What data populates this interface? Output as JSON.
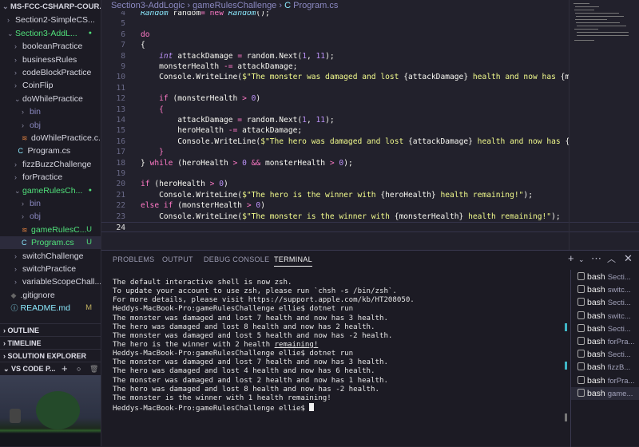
{
  "sidebar": {
    "root": "MS-FCC-CSHARP-COUR...",
    "items": [
      {
        "label": "Section2-SimpleCS...",
        "chev": ">",
        "depth": 1,
        "color": "#d6d6e0"
      },
      {
        "label": "Section3-AddL...",
        "chev": "v",
        "depth": 1,
        "color": "#50e07a",
        "badge": "●"
      },
      {
        "label": "booleanPractice",
        "chev": ">",
        "depth": 2,
        "color": "#d6d6e0"
      },
      {
        "label": "businessRules",
        "chev": ">",
        "depth": 2,
        "color": "#d6d6e0"
      },
      {
        "label": "codeBlockPractice",
        "chev": ">",
        "depth": 2,
        "color": "#d6d6e0"
      },
      {
        "label": "CoinFlip",
        "chev": ">",
        "depth": 2,
        "color": "#d6d6e0"
      },
      {
        "label": "doWhilePractice",
        "chev": "v",
        "depth": 2,
        "color": "#d6d6e0"
      },
      {
        "label": "bin",
        "chev": ">",
        "depth": 3,
        "color": "#8a88c0"
      },
      {
        "label": "obj",
        "chev": ">",
        "depth": 3,
        "color": "#8a88c0"
      },
      {
        "label": "doWhilePractice.c...",
        "icon": "rss",
        "depth": 3,
        "color": "#d6d6e0"
      },
      {
        "label": "Program.cs",
        "icon": "cs",
        "depth": 2.5,
        "color": "#d6d6e0"
      },
      {
        "label": "fizzBuzzChallenge",
        "chev": ">",
        "depth": 2,
        "color": "#d6d6e0"
      },
      {
        "label": "forPractice",
        "chev": ">",
        "depth": 2,
        "color": "#d6d6e0"
      },
      {
        "label": "gameRulesCh...",
        "chev": "v",
        "depth": 2,
        "color": "#50e07a",
        "badge": "●"
      },
      {
        "label": "bin",
        "chev": ">",
        "depth": 3,
        "color": "#8a88c0"
      },
      {
        "label": "obj",
        "chev": ">",
        "depth": 3,
        "color": "#8a88c0"
      },
      {
        "label": "gameRulesC...",
        "icon": "rss",
        "depth": 3,
        "color": "#50e07a",
        "badge": "U"
      },
      {
        "label": "Program.cs",
        "icon": "cs",
        "depth": 3,
        "color": "#50e07a",
        "badge": "U",
        "selected": true
      },
      {
        "label": "switchChallenge",
        "chev": ">",
        "depth": 2,
        "color": "#d6d6e0"
      },
      {
        "label": "switchPractice",
        "chev": ">",
        "depth": 2,
        "color": "#d6d6e0"
      },
      {
        "label": "variableScopeChall...",
        "chev": ">",
        "depth": 2,
        "color": "#d6d6e0"
      },
      {
        "label": ".gitignore",
        "icon": "git",
        "depth": 1.5,
        "color": "#d6d6e0"
      },
      {
        "label": "README.md",
        "icon": "info",
        "depth": 1.5,
        "color": "#8be9fd",
        "badge": "M"
      }
    ],
    "sections": [
      "OUTLINE",
      "TIMELINE",
      "SOLUTION EXPLORER"
    ],
    "pets_title": "VS CODE P..."
  },
  "breadcrumb": {
    "folder": "Section3-AddLogic",
    "sub": "gameRulesChallenge",
    "file": "Program.cs"
  },
  "code": [
    {
      "n": "4",
      "t": [
        [
          "Random ",
          "cls"
        ],
        [
          "random",
          "id"
        ],
        [
          "= ",
          "op"
        ],
        [
          "new ",
          "kw"
        ],
        [
          "Random",
          "cls"
        ],
        [
          "();",
          "id"
        ]
      ]
    },
    {
      "n": "5",
      "t": []
    },
    {
      "n": "6",
      "t": [
        [
          "do",
          "kw"
        ]
      ]
    },
    {
      "n": "7",
      "t": [
        [
          "{",
          "id"
        ]
      ]
    },
    {
      "n": "8",
      "t": [
        [
          "    ",
          "id"
        ],
        [
          "int ",
          "type"
        ],
        [
          "attackDamage ",
          "id"
        ],
        [
          "= ",
          "op"
        ],
        [
          "random.Next(",
          "id"
        ],
        [
          "1",
          "num"
        ],
        [
          ", ",
          "id"
        ],
        [
          "11",
          "num"
        ],
        [
          ");",
          "id"
        ]
      ]
    },
    {
      "n": "9",
      "t": [
        [
          "    monsterHealth ",
          "id"
        ],
        [
          "-= ",
          "op"
        ],
        [
          "attackDamage;",
          "id"
        ]
      ]
    },
    {
      "n": "10",
      "t": [
        [
          "    Console.WriteLine(",
          "id"
        ],
        [
          "$\"The monster was damaged and lost ",
          "str"
        ],
        [
          "{attackDamage}",
          "id"
        ],
        [
          " health and now has ",
          "str"
        ],
        [
          "{monsterHealth}",
          "id"
        ]
      ]
    },
    {
      "n": "11",
      "t": []
    },
    {
      "n": "12",
      "t": [
        [
          "    ",
          "id"
        ],
        [
          "if ",
          "kw"
        ],
        [
          "(monsterHealth ",
          "id"
        ],
        [
          "> ",
          "op"
        ],
        [
          "0",
          "num"
        ],
        [
          ")",
          "id"
        ]
      ]
    },
    {
      "n": "13",
      "t": [
        [
          "    {",
          "kw"
        ]
      ]
    },
    {
      "n": "14",
      "t": [
        [
          "        attackDamage ",
          "id"
        ],
        [
          "= ",
          "op"
        ],
        [
          "random.Next(",
          "id"
        ],
        [
          "1",
          "num"
        ],
        [
          ", ",
          "id"
        ],
        [
          "11",
          "num"
        ],
        [
          ");",
          "id"
        ]
      ]
    },
    {
      "n": "15",
      "t": [
        [
          "        heroHealth ",
          "id"
        ],
        [
          "-= ",
          "op"
        ],
        [
          "attackDamage;",
          "id"
        ]
      ]
    },
    {
      "n": "16",
      "t": [
        [
          "        Console.WriteLine(",
          "id"
        ],
        [
          "$\"The hero was damaged and lost ",
          "str"
        ],
        [
          "{attackDamage}",
          "id"
        ],
        [
          " health and now has ",
          "str"
        ],
        [
          "{heroHealth}",
          "id"
        ]
      ]
    },
    {
      "n": "17",
      "t": [
        [
          "    }",
          "kw"
        ]
      ]
    },
    {
      "n": "18",
      "t": [
        [
          "} ",
          "id"
        ],
        [
          "while ",
          "kw"
        ],
        [
          "(heroHealth ",
          "id"
        ],
        [
          "> ",
          "op"
        ],
        [
          "0 ",
          "num"
        ],
        [
          "&& ",
          "op"
        ],
        [
          "monsterHealth ",
          "id"
        ],
        [
          "> ",
          "op"
        ],
        [
          "0",
          "num"
        ],
        [
          ");",
          "id"
        ]
      ]
    },
    {
      "n": "19",
      "t": []
    },
    {
      "n": "20",
      "t": [
        [
          "if ",
          "kw"
        ],
        [
          "(heroHealth ",
          "id"
        ],
        [
          "> ",
          "op"
        ],
        [
          "0",
          "num"
        ],
        [
          ")",
          "id"
        ]
      ]
    },
    {
      "n": "21",
      "t": [
        [
          "    Console.WriteLine(",
          "id"
        ],
        [
          "$\"The hero is the winner with ",
          "str"
        ],
        [
          "{heroHealth}",
          "id"
        ],
        [
          " health remaining!\"",
          "str"
        ],
        [
          ");",
          "id"
        ]
      ]
    },
    {
      "n": "22",
      "t": [
        [
          "else if ",
          "kw"
        ],
        [
          "(monsterHealth ",
          "id"
        ],
        [
          "> ",
          "op"
        ],
        [
          "0",
          "num"
        ],
        [
          ")",
          "id"
        ]
      ]
    },
    {
      "n": "23",
      "t": [
        [
          "    Console.WriteLine(",
          "id"
        ],
        [
          "$\"The monster is the winner with ",
          "str"
        ],
        [
          "{monsterHealth}",
          "id"
        ],
        [
          " health remaining!\"",
          "str"
        ],
        [
          ");",
          "id"
        ]
      ]
    },
    {
      "n": "24",
      "t": [],
      "current": true
    }
  ],
  "panel": {
    "tabs": [
      "PROBLEMS",
      "OUTPUT",
      "DEBUG CONSOLE",
      "TERMINAL"
    ],
    "active_tab": "TERMINAL",
    "terminal_lines": [
      {
        "text": "The default interactive shell is now zsh."
      },
      {
        "text": "To update your account to use zsh, please run `chsh -s /bin/zsh`."
      },
      {
        "text": "For more details, please visit https://support.apple.com/kb/HT208050."
      },
      {
        "text": "Heddys-MacBook-Pro:gameRulesChallenge ellie$ dotnet run",
        "dot": "#3fa0e0"
      },
      {
        "text": "The monster was damaged and lost 7 health and now has 3 health."
      },
      {
        "text": "The hero was damaged and lost 8 health and now has 2 health."
      },
      {
        "text": "The monster was damaged and lost 5 health and now has -2 health."
      },
      {
        "text": "The hero is the winner with 2 health ",
        "underline": "remaining!"
      },
      {
        "text": "Heddys-MacBook-Pro:gameRulesChallenge ellie$ dotnet run",
        "dot": "#3fa0e0"
      },
      {
        "text": "The monster was damaged and lost 7 health and now has 3 health."
      },
      {
        "text": "The hero was damaged and lost 4 health and now has 6 health."
      },
      {
        "text": "The monster was damaged and lost 2 health and now has 1 health."
      },
      {
        "text": "The hero was damaged and lost 8 health and now has -2 health."
      },
      {
        "text": "The monster is the winner with 1 health remaining!"
      },
      {
        "text": "Heddys-MacBook-Pro:gameRulesChallenge ellie$ ",
        "dot": "hollow",
        "caret": true
      }
    ],
    "terminals": [
      {
        "shell": "bash",
        "name": "Secti..."
      },
      {
        "shell": "bash",
        "name": "switc..."
      },
      {
        "shell": "bash",
        "name": "Secti..."
      },
      {
        "shell": "bash",
        "name": "switc..."
      },
      {
        "shell": "bash",
        "name": "Secti..."
      },
      {
        "shell": "bash",
        "name": "forPra..."
      },
      {
        "shell": "bash",
        "name": "Secti..."
      },
      {
        "shell": "bash",
        "name": "fizzB..."
      },
      {
        "shell": "bash",
        "name": "forPra..."
      },
      {
        "shell": "bash",
        "name": "game...",
        "selected": true
      }
    ]
  }
}
